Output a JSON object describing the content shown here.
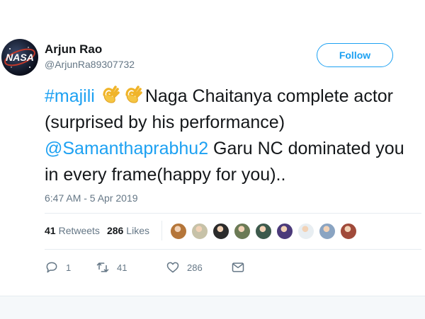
{
  "user": {
    "name": "Arjun Rao",
    "handle": "@ArjunRa89307732",
    "avatar_text": "NASA"
  },
  "follow_button": {
    "label": "Follow"
  },
  "tweet": {
    "hashtag": "#majili",
    "emoji": [
      "ok-hand-emoji",
      "ok-hand-emoji"
    ],
    "text_part1": "Naga Chaitanya complete actor (surprised by his performance) ",
    "mention": "@Samanthaprabhu2",
    "text_part2": " Garu NC dominated you in every frame(happy for you).."
  },
  "timestamp": "6:47 AM - 5 Apr 2019",
  "stats": {
    "retweets_count": "41",
    "retweets_label": "Retweets",
    "likes_count": "286",
    "likes_label": "Likes"
  },
  "liker_avatars": [
    "#b5763a",
    "#c7c2a8",
    "#2b2b2b",
    "#6b7a55",
    "#3d5a4c",
    "#4b3a7a",
    "#e8eef2",
    "#8aa4c2",
    "#a04a3a"
  ],
  "actions": {
    "reply_count": "1",
    "retweet_count": "41",
    "like_count": "286"
  },
  "colors": {
    "accent": "#1da1f2",
    "secondary_text": "#657786"
  }
}
